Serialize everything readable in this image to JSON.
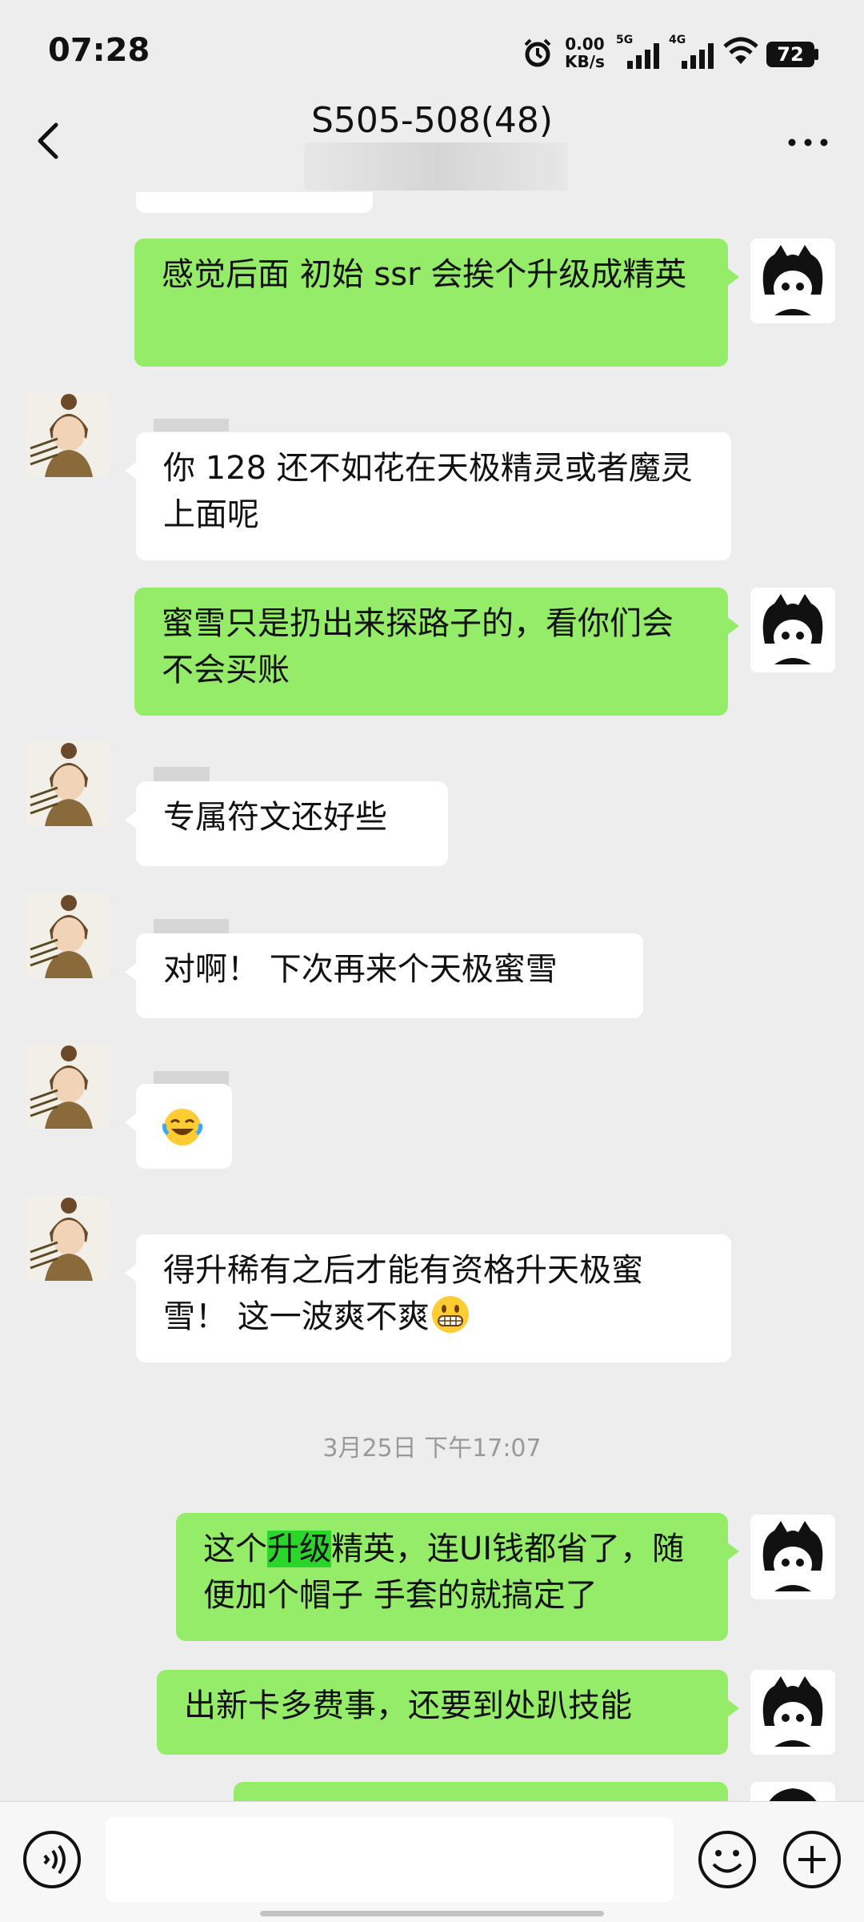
{
  "status_bar": {
    "time": "07:28",
    "net_speed_value": "0.00",
    "net_speed_unit": "KB/s",
    "signal1_label": "5G",
    "signal2_label": "4G",
    "battery": "72"
  },
  "header": {
    "title": "S505-508(48)"
  },
  "messages": [
    {
      "sender": "me",
      "text": "感觉后面 初始 ssr 会挨个升级成精英"
    },
    {
      "sender": "other",
      "text": "你 128 还不如花在天极精灵或者魔灵上面呢"
    },
    {
      "sender": "me",
      "text": "蜜雪只是扔出来探路子的，看你们会不会买账"
    },
    {
      "sender": "other",
      "text": "专属符文还好些"
    },
    {
      "sender": "other",
      "text": "对啊！ 下次再来个天极蜜雪"
    },
    {
      "sender": "other",
      "text": ""
    },
    {
      "sender": "other",
      "text": "得升稀有之后才能有资格升天极蜜雪！ 这一波爽不爽"
    },
    {
      "sender": "me",
      "text_a": "这个",
      "text_highlight": "升级",
      "text_b": "精英，连UI钱都省了，随便加个帽子 手套的就搞定了"
    },
    {
      "sender": "me",
      "text": "出新卡多费事，还要到处趴技能"
    }
  ],
  "date_separator": "3月25日 下午17:07",
  "colors": {
    "my_bubble": "#95ec69",
    "their_bubble": "#ffffff",
    "background": "#ededed",
    "highlight": "#2bd62b"
  },
  "icons": [
    "back-icon",
    "more-icon",
    "alarm-icon",
    "signal-icon",
    "wifi-icon",
    "battery-icon",
    "voice-icon",
    "emoji-icon",
    "plus-icon"
  ]
}
